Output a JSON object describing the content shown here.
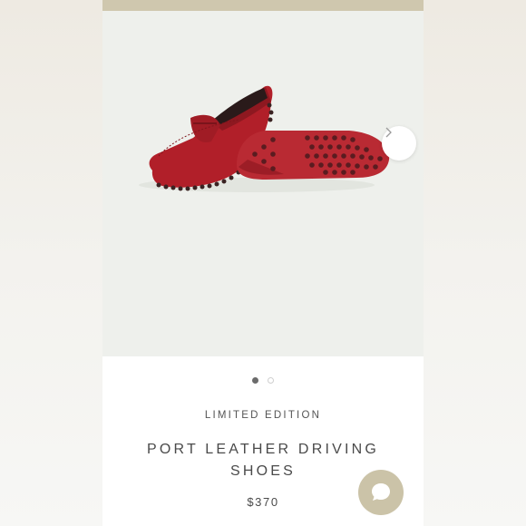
{
  "product": {
    "tag": "LIMITED EDITION",
    "title": "PORT LEATHER DRIVING SHOES",
    "price": "$370"
  },
  "gallery": {
    "image_count": 2,
    "active_index": 0,
    "next_icon": "chevron-right-icon"
  },
  "chat": {
    "icon": "chat-bubble-icon"
  },
  "colors": {
    "accent": "#cbc3a8",
    "top_bar": "#cfc7ae",
    "image_background": "#eef0ec",
    "shoe_red": "#b3202a",
    "text": "#4a4a4a"
  }
}
